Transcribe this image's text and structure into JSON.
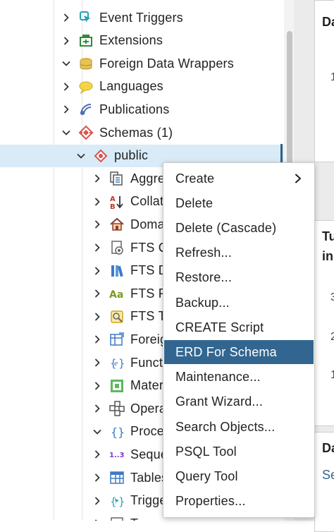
{
  "tree": {
    "items": [
      {
        "label": "Event Triggers",
        "icon": "event-triggers-icon",
        "expand": "collapsed",
        "level": 0
      },
      {
        "label": "Extensions",
        "icon": "extensions-icon",
        "expand": "collapsed",
        "level": 0
      },
      {
        "label": "Foreign Data Wrappers",
        "icon": "foreign-data-wrappers-icon",
        "expand": "expanded",
        "level": 0
      },
      {
        "label": "Languages",
        "icon": "languages-icon",
        "expand": "collapsed",
        "level": 0
      },
      {
        "label": "Publications",
        "icon": "publications-icon",
        "expand": "collapsed",
        "level": 0
      },
      {
        "label": "Schemas (1)",
        "icon": "schemas-icon",
        "expand": "expanded",
        "level": 0
      },
      {
        "label": "public",
        "icon": "schema-icon",
        "expand": "expanded",
        "level": 1,
        "selected": true
      },
      {
        "label": "Aggre",
        "icon": "aggregates-icon",
        "expand": "collapsed",
        "level": 2
      },
      {
        "label": "Collati",
        "icon": "collations-icon",
        "expand": "collapsed",
        "level": 2
      },
      {
        "label": "Doma",
        "icon": "domains-icon",
        "expand": "collapsed",
        "level": 2
      },
      {
        "label": "FTS C",
        "icon": "fts-configurations-icon",
        "expand": "collapsed",
        "level": 2
      },
      {
        "label": "FTS D",
        "icon": "fts-dictionaries-icon",
        "expand": "collapsed",
        "level": 2
      },
      {
        "label": "FTS Pa",
        "icon": "fts-parsers-icon",
        "expand": "collapsed",
        "level": 2
      },
      {
        "label": "FTS Te",
        "icon": "fts-templates-icon",
        "expand": "collapsed",
        "level": 2
      },
      {
        "label": "Foreig",
        "icon": "foreign-tables-icon",
        "expand": "collapsed",
        "level": 2
      },
      {
        "label": "Functi",
        "icon": "functions-icon",
        "expand": "collapsed",
        "level": 2
      },
      {
        "label": "Mater",
        "icon": "materialized-views-icon",
        "expand": "collapsed",
        "level": 2
      },
      {
        "label": "Opera",
        "icon": "operators-icon",
        "expand": "collapsed",
        "level": 2
      },
      {
        "label": "Proce",
        "icon": "procedures-icon",
        "expand": "expanded",
        "level": 2
      },
      {
        "label": "Seque",
        "icon": "sequences-icon",
        "expand": "collapsed",
        "level": 2
      },
      {
        "label": "Tables",
        "icon": "tables-icon",
        "expand": "collapsed",
        "level": 2
      },
      {
        "label": "Trigge",
        "icon": "trigger-functions-icon",
        "expand": "collapsed",
        "level": 2
      },
      {
        "label": "T",
        "icon": "types-icon",
        "expand": "collapsed",
        "level": 2
      }
    ]
  },
  "context_menu": {
    "items": [
      {
        "label": "Create",
        "submenu": true
      },
      {
        "label": "Delete"
      },
      {
        "label": "Delete (Cascade)"
      },
      {
        "label": "Refresh..."
      },
      {
        "label": "Restore..."
      },
      {
        "label": "Backup..."
      },
      {
        "label": "CREATE Script"
      },
      {
        "label": "ERD For Schema",
        "active": true
      },
      {
        "label": "Maintenance..."
      },
      {
        "label": "Grant Wizard..."
      },
      {
        "label": "Search Objects..."
      },
      {
        "label": "PSQL Tool"
      },
      {
        "label": "Query Tool"
      },
      {
        "label": "Properties..."
      }
    ]
  },
  "right_panels": {
    "p1_title": "Da",
    "p1_num": "1",
    "p2_title_a": "Tu",
    "p2_title_b": "in",
    "p2_num_a": "3",
    "p2_num_b": "2",
    "p2_num_c": "1",
    "p3_title": "Da",
    "p3_sub": "Se"
  },
  "colors": {
    "selection_bg": "#d8ebf7",
    "menu_active_bg": "#326690",
    "accent": "#2e5f88"
  }
}
